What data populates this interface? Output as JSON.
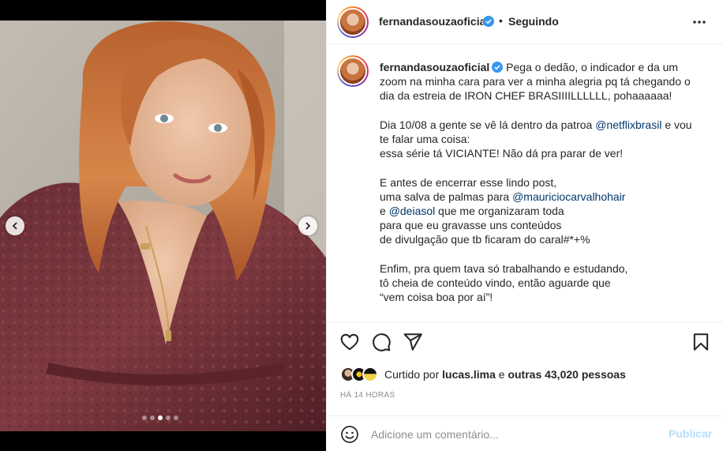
{
  "colors": {
    "verified": "#3897f0",
    "mention": "#00376b",
    "text": "#262626",
    "muted": "#8e8e8e",
    "publish_disabled": "#b2dffc",
    "border": "#efefef"
  },
  "carousel": {
    "total_slides": 5,
    "active_slide": 3
  },
  "header": {
    "username": "fernandasouzaoficial",
    "separator": "•",
    "follow_status": "Seguindo",
    "more_icon": "more-horizontal-icon"
  },
  "caption": {
    "username": "fernandasouzaoficial",
    "first_line": "Pega o dedão, o indicador e da um zoom na minha cara para ver a minha alegria pq tá chegando o dia da estreia de IRON CHEF BRASIIIILLLLLL, pohaaaaaa!",
    "para2_pre": "Dia 10/08 a gente se vê lá dentro da patroa ",
    "para2_mention": "@netflixbrasil",
    "para2_post": " e vou te falar uma coisa:",
    "para2_line3": "essa série tá VICIANTE! Não dá pra parar de ver!",
    "para3_line1": "E antes de encerrar esse lindo post,",
    "para3_line2_pre": "uma salva de palmas para ",
    "para3_mention1": "@mauriciocarvalhohair",
    "para3_line3_pre": "e ",
    "para3_mention2": "@deiasol",
    "para3_line3_post": " que me organizaram toda",
    "para3_line4": "para que eu gravasse uns conteúdos",
    "para3_line5": "de divulgação que tb ficaram do caral#*+%",
    "para4_line1": "Enfim, pra quem tava só trabalhando e estudando,",
    "para4_line2": "tô cheia de conteúdo vindo, então aguarde que",
    "para4_line3": "“vem coisa boa por aí”!"
  },
  "actions": {
    "like_icon": "heart-icon",
    "comment_icon": "comment-icon",
    "share_icon": "paper-plane-icon",
    "save_icon": "bookmark-icon"
  },
  "likes": {
    "prefix": "Curtido por",
    "first_user": "lucas.lima",
    "connector": "e",
    "others": "outras 43,020 pessoas"
  },
  "time_ago": "HÁ 14 HORAS",
  "comment": {
    "placeholder": "Adicione um comentário...",
    "publish_label": "Publicar",
    "emoji_icon": "smiley-icon"
  }
}
